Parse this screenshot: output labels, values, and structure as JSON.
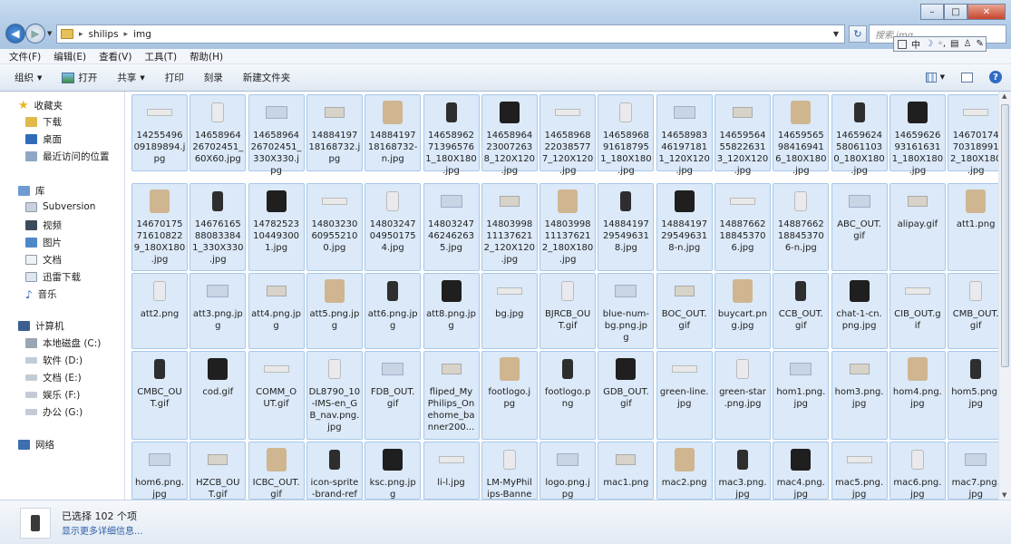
{
  "window": {
    "breadcrumb": [
      "shilips",
      "img"
    ],
    "search_placeholder": "搜索 img",
    "ime_label": "中"
  },
  "menu": [
    "文件(F)",
    "编辑(E)",
    "查看(V)",
    "工具(T)",
    "帮助(H)"
  ],
  "toolbar": {
    "organize": "组织",
    "open": "打开",
    "share": "共享",
    "print": "打印",
    "burn": "刻录",
    "new_folder": "新建文件夹"
  },
  "nav": {
    "favorites": "收藏夹",
    "downloads": "下载",
    "desktop": "桌面",
    "recent": "最近访问的位置",
    "library": "库",
    "subversion": "Subversion",
    "videos": "视频",
    "pictures": "图片",
    "documents": "文档",
    "xunlei": "迅雷下载",
    "music": "音乐",
    "computer": "计算机",
    "drive_c": "本地磁盘 (C:)",
    "drive_d": "软件 (D:)",
    "drive_e": "文档 (E:)",
    "drive_f": "娱乐 (F:)",
    "drive_g": "办公 (G:)",
    "network": "网络"
  },
  "files": [
    [
      "14255496\n09189894.j\npg",
      "14658964\n26702451_\n60X60.jpg",
      "14658964\n26702451_\n330X330.j\npg",
      "14884197\n18168732.j\npg",
      "14884197\n18168732-\nn.jpg",
      "14658962\n71396576\n1_180X180\n.jpg",
      "14658964\n23007263\n8_120X120\n.jpg",
      "14658968\n22038577\n7_120X120\n.jpg",
      "14658968\n91618795\n1_180X180\n.jpg",
      "14658983\n46197181\n1_120X120\n.jpg",
      "14659564\n55822631\n3_120X120\n.jpg",
      "14659565\n98416941\n6_180X180\n.jpg",
      "14659624\n58061103\n0_180X180\n.jpg",
      "14659626\n93161631\n1_180X180\n.jpg",
      "14670174\n70318991\n2_180X180\n.jpg"
    ],
    [
      "14670175\n71610822\n9_180X180\n.jpg",
      "14676165\n88083384\n1_330X330\n.jpg",
      "14782523\n10449300\n1.jpg",
      "14803230\n60955210\n0.jpg",
      "14803247\n04950175\n4.jpg",
      "14803247\n46246263\n5.jpg",
      "14803998\n11137621\n2_120X120\n.jpg",
      "14803998\n11137621\n2_180X180\n.jpg",
      "14884197\n29549631\n8.jpg",
      "14884197\n29549631\n8-n.jpg",
      "14887662\n18845370\n6.jpg",
      "14887662\n18845370\n6-n.jpg",
      "ABC_OUT.\ngif",
      "alipay.gif",
      "att1.png"
    ],
    [
      "att2.png",
      "att3.png.jp\ng",
      "att4.png.jp\ng",
      "att5.png.jp\ng",
      "att6.png.jp\ng",
      "att8.png.jp\ng",
      "bg.jpg",
      "BJRCB_OU\nT.gif",
      "blue-num-\nbg.png.jp\ng",
      "BOC_OUT.\ngif",
      "buycart.pn\ng.jpg",
      "CCB_OUT.\ngif",
      "chat-1-cn.\npng.jpg",
      "CIB_OUT.g\nif",
      "CMB_OUT.\ngif"
    ],
    [
      "CMBC_OU\nT.gif",
      "cod.gif",
      "COMM_O\nUT.gif",
      "DL8790_10\n-IMS-en_G\nB_nav.png.\njpg",
      "FDB_OUT.\ngif",
      "fliped_My\nPhilips_On\nehome_ba\nnner200...",
      "footlogo.j\npg",
      "footlogo.p\nng",
      "GDB_OUT.\ngif",
      "green-line.\njpg",
      "green-star\n.png.jpg",
      "hom1.png.\njpg",
      "hom3.png.\njpg",
      "hom4.png.\njpg",
      "hom5.png.\njpg"
    ],
    [
      "hom6.png.\njpg",
      "HZCB_OU\nT.gif",
      "ICBC_OUT.\ngif",
      "icon-sprite\n-brand-ref",
      "ksc.png.jp\ng",
      "li-l.jpg",
      "LM-MyPhil\nips-Banne",
      "logo.png.j\npg",
      "mac1.png",
      "mac2.png",
      "mac3.png.\njpg",
      "mac4.png.\njpg",
      "mac5.png.\njpg",
      "mac6.png.\njpg",
      "mac7.png.\njpg"
    ]
  ],
  "details": {
    "selected": "已选择 102 个项",
    "more": "显示更多详细信息..."
  }
}
